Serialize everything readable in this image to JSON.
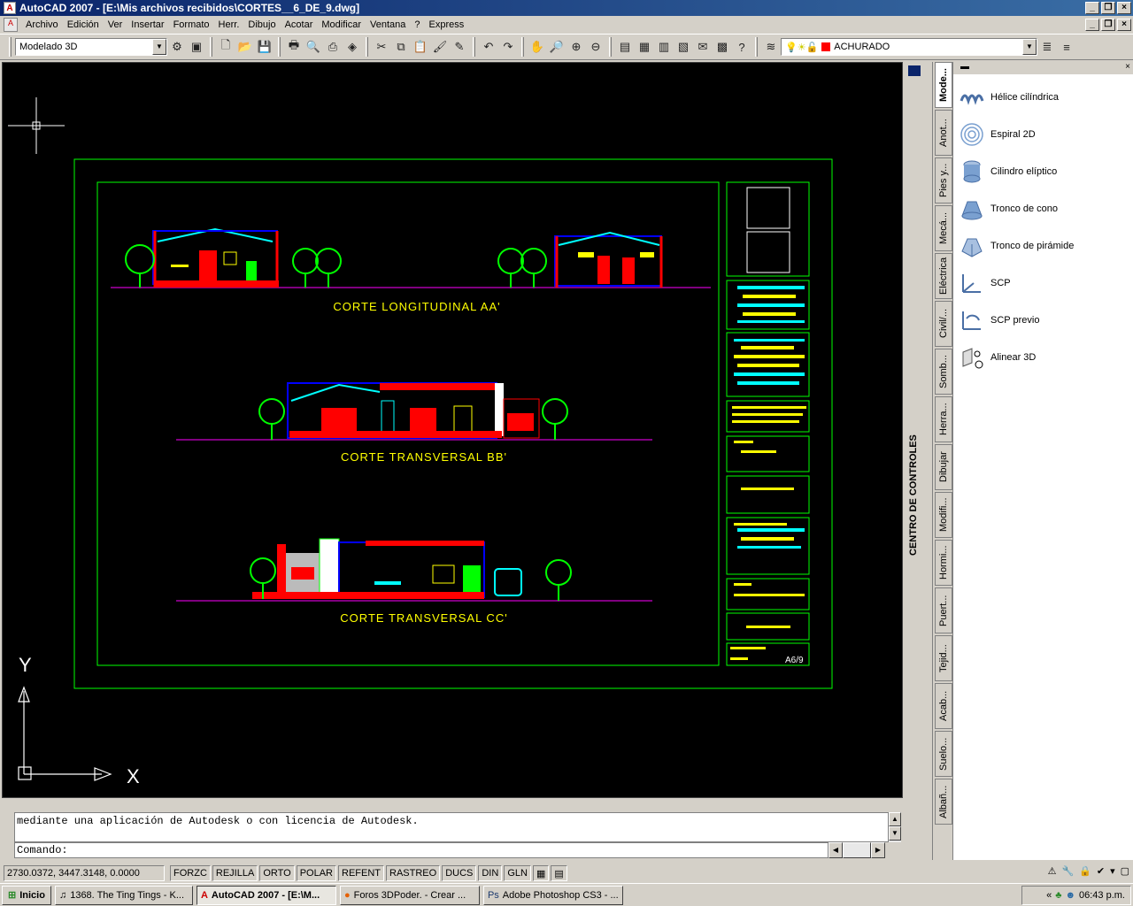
{
  "window": {
    "title": "AutoCAD 2007 - [E:\\Mis archivos recibidos\\CORTES__6_DE_9.dwg]"
  },
  "menu": [
    "Archivo",
    "Edición",
    "Ver",
    "Insertar",
    "Formato",
    "Herr.",
    "Dibujo",
    "Acotar",
    "Modificar",
    "Ventana",
    "?",
    "Express"
  ],
  "toolbar": {
    "workspace": "Modelado 3D",
    "layer": "ACHURADO"
  },
  "drawing": {
    "sections": [
      "CORTE LONGITUDINAL AA'",
      "CORTE TRANSVERSAL BB'",
      "CORTE TRANSVERSAL CC'"
    ],
    "sheet_number": "A6/9",
    "axis_x": "X",
    "axis_y": "Y",
    "colors": {
      "background": "#000000",
      "frame": "#00ff00",
      "section_text": "#ffff00",
      "accent_cyan": "#00ffff",
      "accent_red": "#ff0000",
      "accent_blue": "#0000ff"
    }
  },
  "command": {
    "history": "mediante una aplicación de Autodesk o con licencia de Autodesk.",
    "prompt": "Comando:"
  },
  "status": {
    "coords": "2730.0372, 3447.3148, 0.0000",
    "buttons": [
      "FORZC",
      "REJILLA",
      "ORTO",
      "POLAR",
      "REFENT",
      "RASTREO",
      "DUCS",
      "DIN",
      "GLN"
    ]
  },
  "panel": {
    "control_center_label": "CENTRO DE CONTROLES",
    "tabs": [
      "Mode...",
      "Anot...",
      "Pies y...",
      "Mecá...",
      "Eléctrica",
      "Civil/...",
      "Somb...",
      "Herra...",
      "Dibujar",
      "Modifi...",
      "Hormi...",
      "Puert...",
      "Tejid...",
      "Acab...",
      "Suelo...",
      "Albañ..."
    ],
    "items": [
      {
        "label": "Hélice cilíndrica",
        "icon": "helix-icon"
      },
      {
        "label": "Espiral 2D",
        "icon": "spiral-icon"
      },
      {
        "label": "Cilindro elíptico",
        "icon": "cylinder-icon"
      },
      {
        "label": "Tronco de cono",
        "icon": "cone-icon"
      },
      {
        "label": "Tronco de pirámide",
        "icon": "pyramid-icon"
      },
      {
        "label": "SCP",
        "icon": "ucs-icon"
      },
      {
        "label": "SCP previo",
        "icon": "ucs-previous-icon"
      },
      {
        "label": "Alinear 3D",
        "icon": "align-3d-icon"
      }
    ]
  },
  "taskbar": {
    "start": "Inicio",
    "tasks": [
      "1368. The Ting Tings - K...",
      "AutoCAD 2007 - [E:\\M...",
      "Foros 3DPoder. - Crear ...",
      "Adobe Photoshop CS3 - ..."
    ],
    "clock": "06:43 p.m."
  }
}
